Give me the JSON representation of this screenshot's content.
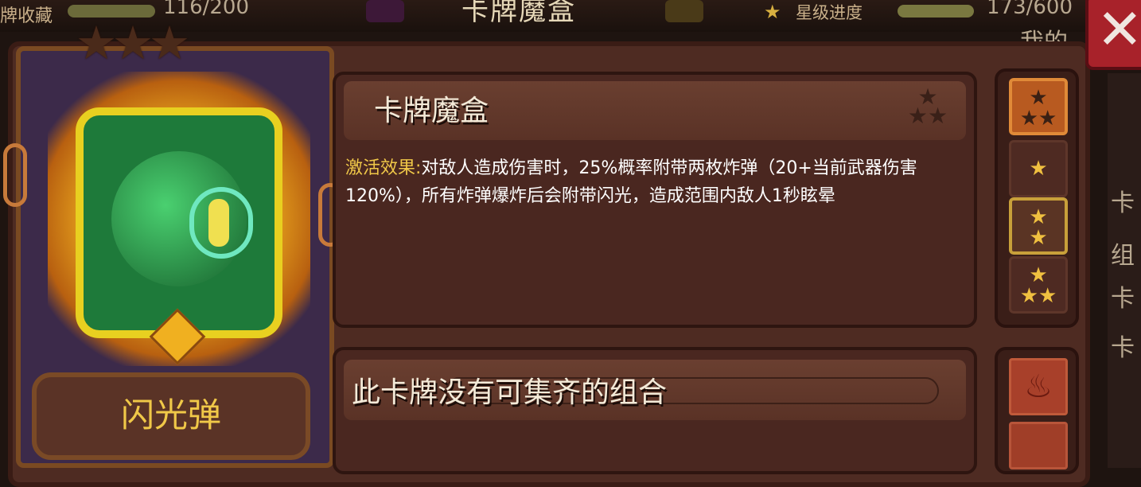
{
  "top_bar": {
    "collection_label": "牌收藏",
    "collection_count": "116/200",
    "title": "卡牌魔盒",
    "star_progress_label": "星级进度",
    "star_progress_count": "173/600"
  },
  "close_button": {
    "icon": "close-icon",
    "glyph": "✕"
  },
  "background_right": {
    "text_1": "我的",
    "text_2": "卡",
    "text_3": "组",
    "text_4": "卡",
    "text_5": "卡"
  },
  "card": {
    "name": "闪光弹",
    "stars": "★★★",
    "icon": "flash-bomb-icon"
  },
  "effect": {
    "title": "卡牌魔盒",
    "title_stars": "★\n★★",
    "label": "激活效果:",
    "description": "对敌人造成伤害时，25%概率附带两枚炸弹（20+当前武器伤害120%），所有炸弹爆炸后会附带闪光，造成范围内敌人1秒眩晕"
  },
  "star_tabs": [
    {
      "stars": "★\n★★",
      "selected": true
    },
    {
      "stars": "★",
      "selected": false
    },
    {
      "stars": "★\n★",
      "selected": false
    },
    {
      "stars": "★\n★★",
      "selected": false
    }
  ],
  "combo": {
    "title": "此卡牌没有可集齐的组合",
    "side_icon": "flame-icon",
    "side_glyph": "♨"
  },
  "colors": {
    "accent_gold": "#f0c848",
    "panel_brown": "#4e2b22",
    "close_red": "#a8222a"
  }
}
